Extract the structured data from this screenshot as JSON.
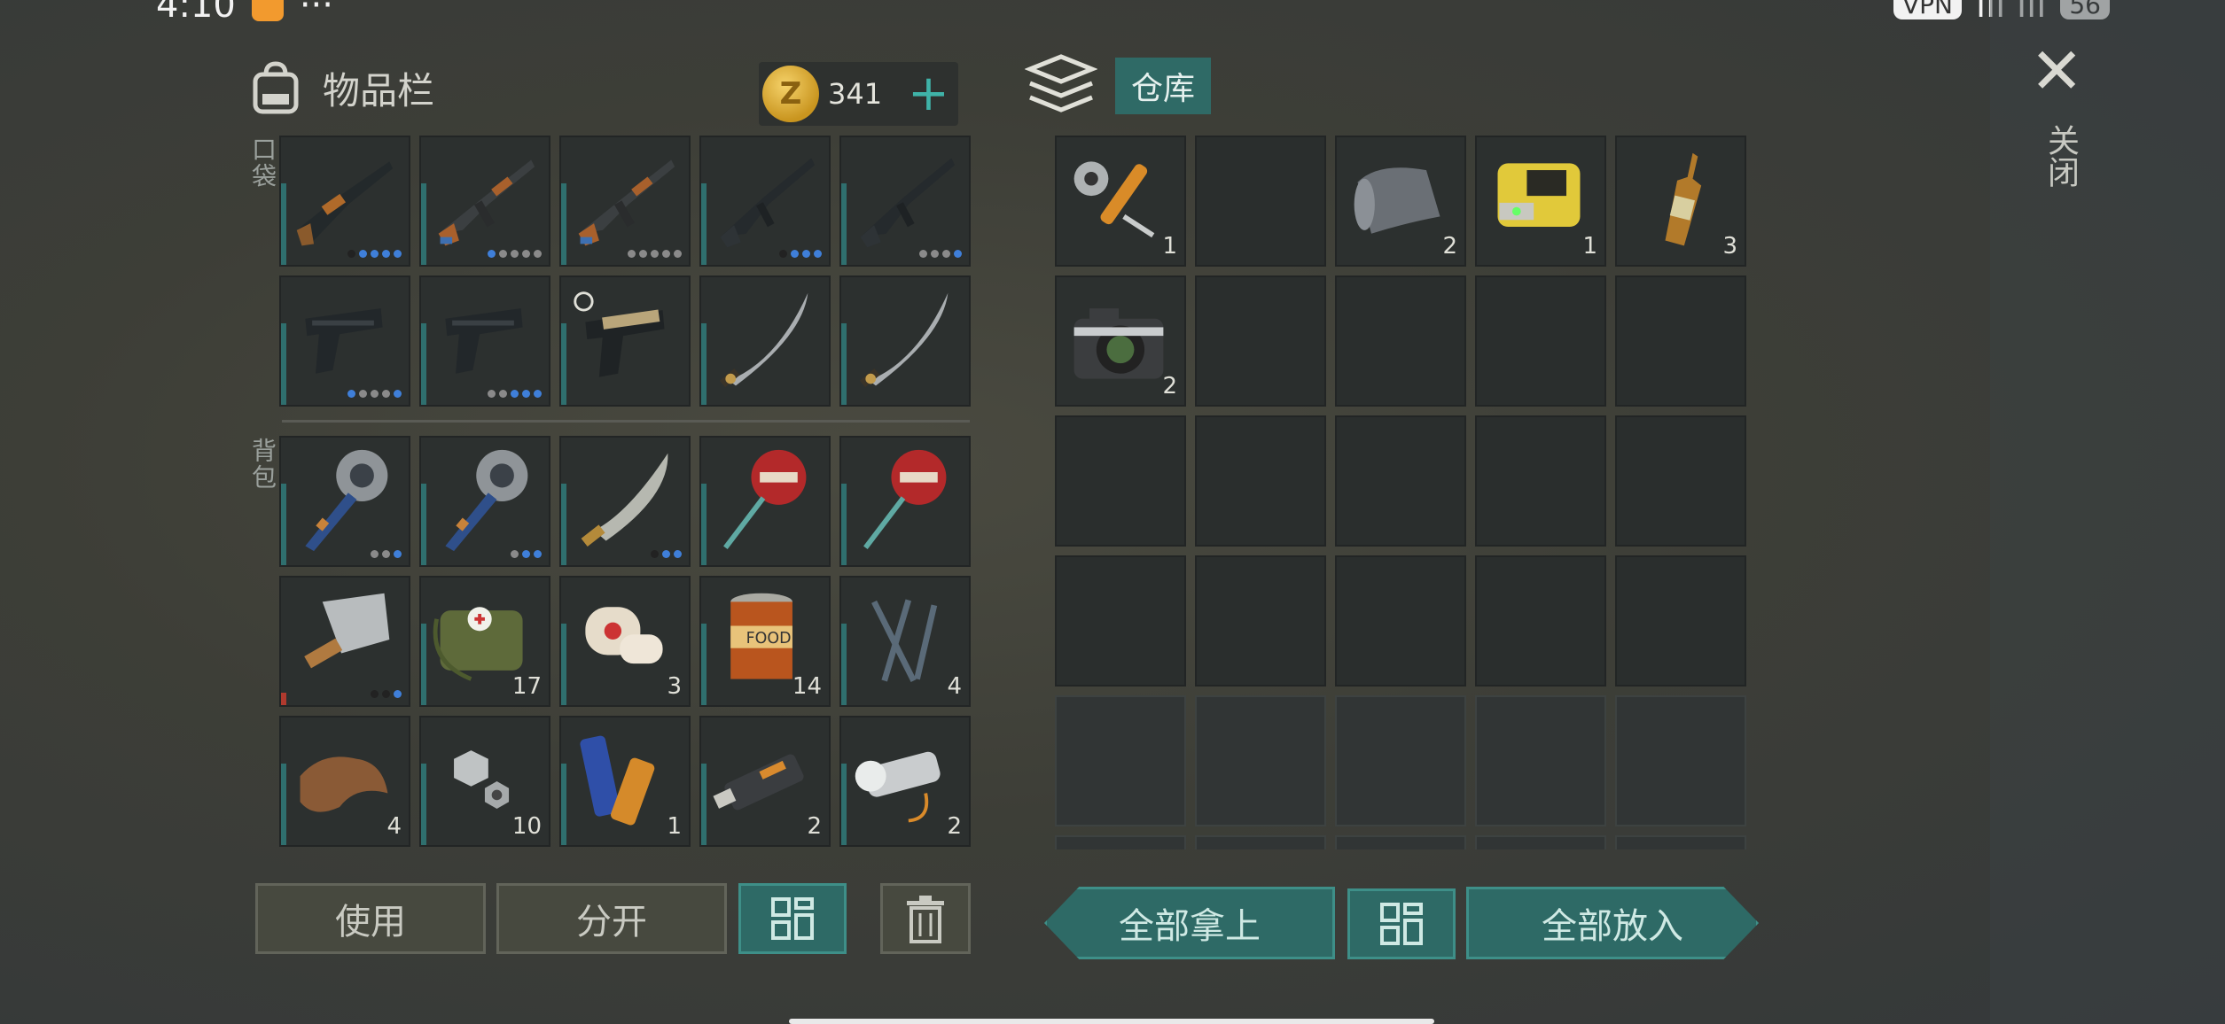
{
  "status_bar": {
    "time": "4:10",
    "dots": "···",
    "vpn": "VPN",
    "battery": "56"
  },
  "inventory": {
    "title": "物品栏",
    "coins": "341",
    "add": "+",
    "pocket_label": "口袋",
    "backpack_label": "背包",
    "pocket_items": [
      {
        "icon": "shotgun-icon",
        "count": "",
        "dots": [
          "d",
          "b",
          "b",
          "b",
          "b"
        ]
      },
      {
        "icon": "ak-rifle-icon",
        "count": "",
        "dots": [
          "b",
          "g",
          "g",
          "g",
          "g"
        ]
      },
      {
        "icon": "ak-rifle-icon",
        "count": "",
        "dots": [
          "g",
          "g",
          "g",
          "g",
          "g"
        ]
      },
      {
        "icon": "m16-rifle-icon",
        "count": "",
        "dots": [
          "d",
          "b",
          "b",
          "b"
        ]
      },
      {
        "icon": "m16-rifle-icon",
        "count": "",
        "dots": [
          "g",
          "g",
          "g",
          "b"
        ]
      },
      {
        "icon": "pistol-icon",
        "count": "",
        "dots": [
          "b",
          "g",
          "g",
          "g",
          "b"
        ]
      },
      {
        "icon": "pistol-icon",
        "count": "",
        "dots": [
          "g",
          "g",
          "b",
          "b",
          "b"
        ]
      },
      {
        "icon": "desert-pistol-icon",
        "count": "",
        "dots": []
      },
      {
        "icon": "katana-icon",
        "count": "",
        "dots": []
      },
      {
        "icon": "katana-icon",
        "count": "",
        "dots": []
      }
    ],
    "backpack_items": [
      {
        "icon": "saw-mace-icon",
        "count": "",
        "dots": [
          "g",
          "g",
          "b"
        ]
      },
      {
        "icon": "saw-mace-icon",
        "count": "",
        "dots": [
          "g",
          "b",
          "b"
        ]
      },
      {
        "icon": "machete-icon",
        "count": "",
        "dots": [
          "d",
          "b",
          "b"
        ]
      },
      {
        "icon": "stop-sign-icon",
        "count": "",
        "dots": []
      },
      {
        "icon": "stop-sign-icon",
        "count": "",
        "dots": []
      },
      {
        "icon": "cleaver-icon",
        "count": "",
        "dots": [
          "d",
          "d",
          "b"
        ]
      },
      {
        "icon": "medkit-bag-icon",
        "count": "17",
        "dots": []
      },
      {
        "icon": "bandage-icon",
        "count": "3",
        "dots": []
      },
      {
        "icon": "canned-food-icon",
        "count": "14",
        "dots": []
      },
      {
        "icon": "nails-icon",
        "count": "4",
        "dots": []
      },
      {
        "icon": "leather-icon",
        "count": "4",
        "dots": []
      },
      {
        "icon": "bolts-icon",
        "count": "10",
        "dots": []
      },
      {
        "icon": "batteries-icon",
        "count": "1",
        "dots": []
      },
      {
        "icon": "usb-drive-icon",
        "count": "2",
        "dots": []
      },
      {
        "icon": "flashlight-icon",
        "count": "2",
        "dots": []
      }
    ],
    "buttons": {
      "use": "使用",
      "split": "分开"
    }
  },
  "storage": {
    "title": "仓库",
    "items": [
      {
        "icon": "hydraulic-parts-icon",
        "count": "1"
      },
      {
        "icon": "",
        "count": ""
      },
      {
        "icon": "cloth-roll-icon",
        "count": "2"
      },
      {
        "icon": "yellow-device-icon",
        "count": "1"
      },
      {
        "icon": "ampoule-icon",
        "count": "3"
      },
      {
        "icon": "camera-icon",
        "count": "2"
      }
    ],
    "buttons": {
      "take_all": "全部拿上",
      "put_all": "全部放入"
    }
  },
  "close_label": "关闭",
  "colors": {
    "teal": "#2e6a66",
    "gold": "#d4a32a",
    "rarity_purple": "#7b7bd6"
  }
}
